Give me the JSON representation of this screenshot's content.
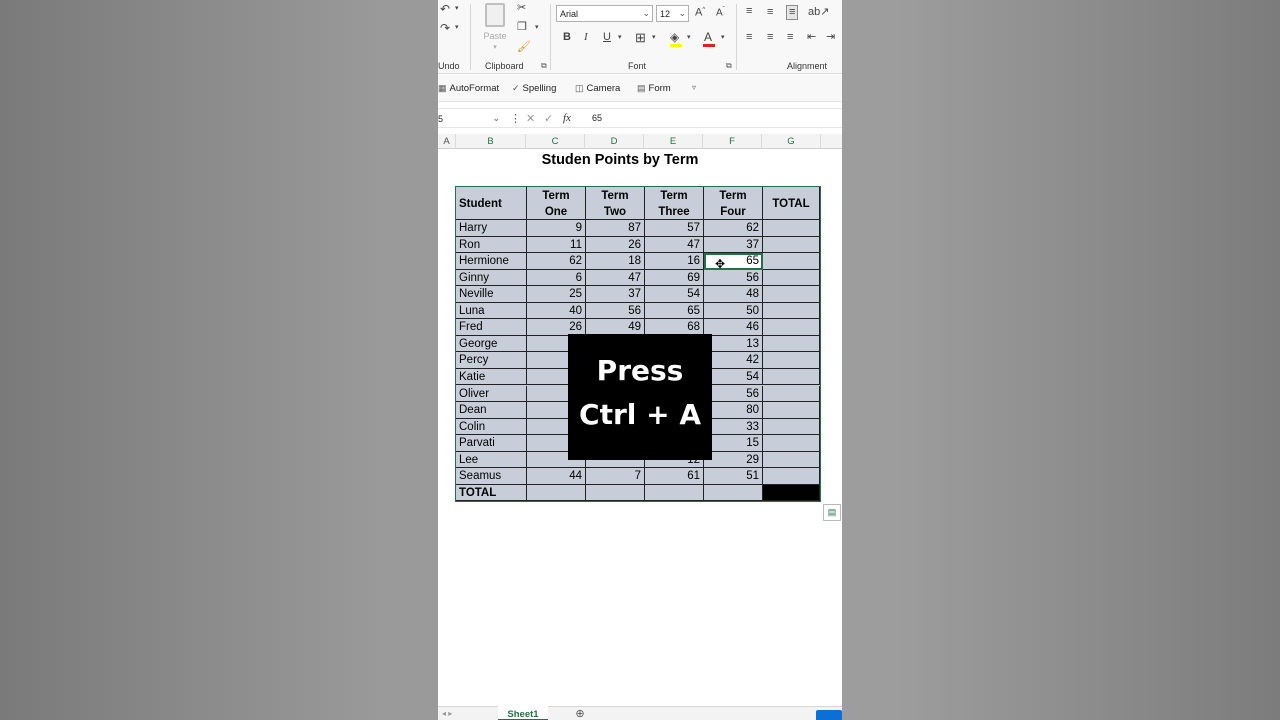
{
  "ribbon": {
    "groups": [
      {
        "key": "undo",
        "label": "Undo"
      },
      {
        "key": "clipboard",
        "label": "Clipboard"
      },
      {
        "key": "font",
        "label": "Font"
      },
      {
        "key": "alignment",
        "label": "Alignment"
      }
    ],
    "paste_label": "Paste",
    "font_name": "Arial",
    "font_size": "12",
    "bold": "B",
    "italic": "I",
    "underline": "U",
    "grow_font": "A",
    "shrink_font": "A",
    "font_color_glyph": "A"
  },
  "qat": {
    "autoformat": "AutoFormat",
    "spelling": "Spelling",
    "camera": "Camera",
    "form": "Form"
  },
  "formula_bar": {
    "name_box": "5",
    "fx": "fx",
    "formula": "65"
  },
  "columns": [
    "A",
    "B",
    "C",
    "D",
    "E",
    "F",
    "G"
  ],
  "active_column": "F",
  "sheet": {
    "title": "Studen Points by Term",
    "headers": {
      "student": "Student",
      "term_one": [
        "Term",
        "One"
      ],
      "term_two": [
        "Term",
        "Two"
      ],
      "term_three": [
        "Term",
        "Three"
      ],
      "term_four": [
        "Term",
        "Four"
      ],
      "total": "TOTAL"
    },
    "rows": [
      {
        "name": "Harry",
        "t1": "9",
        "t2": "87",
        "t3": "57",
        "t4": "62"
      },
      {
        "name": "Ron",
        "t1": "11",
        "t2": "26",
        "t3": "47",
        "t4": "37"
      },
      {
        "name": "Hermione",
        "t1": "62",
        "t2": "18",
        "t3": "16",
        "t4": "65"
      },
      {
        "name": "Ginny",
        "t1": "6",
        "t2": "47",
        "t3": "69",
        "t4": "56"
      },
      {
        "name": "Neville",
        "t1": "25",
        "t2": "37",
        "t3": "54",
        "t4": "48"
      },
      {
        "name": "Luna",
        "t1": "40",
        "t2": "56",
        "t3": "65",
        "t4": "50"
      },
      {
        "name": "Fred",
        "t1": "26",
        "t2": "49",
        "t3": "68",
        "t4": "46"
      },
      {
        "name": "George",
        "t1": "",
        "t2": "",
        "t3": "",
        "t4": "13"
      },
      {
        "name": "Percy",
        "t1": "",
        "t2": "",
        "t3": "",
        "t4": "42"
      },
      {
        "name": "Katie",
        "t1": "",
        "t2": "",
        "t3": "",
        "t4": "54"
      },
      {
        "name": "Oliver",
        "t1": "",
        "t2": "",
        "t3": "",
        "t4": "56"
      },
      {
        "name": "Dean",
        "t1": "",
        "t2": "",
        "t3": "",
        "t4": "80"
      },
      {
        "name": "Colin",
        "t1": "",
        "t2": "",
        "t3": "",
        "t4": "33"
      },
      {
        "name": "Parvati",
        "t1": "",
        "t2": "",
        "t3": "",
        "t4": "15"
      },
      {
        "name": "Lee",
        "t1": "",
        "t2": "",
        "t3": "12",
        "t4": "29"
      },
      {
        "name": "Seamus",
        "t1": "44",
        "t2": "7",
        "t3": "61",
        "t4": "51"
      }
    ],
    "total_label": "TOTAL"
  },
  "overlay": {
    "line1": "Press",
    "line2": "Ctrl + A"
  },
  "tabs": {
    "sheet1": "Sheet1"
  },
  "colors": {
    "excel_green": "#217346",
    "selection_fill": "#c8ced9",
    "overlay_bg": "#000000"
  }
}
